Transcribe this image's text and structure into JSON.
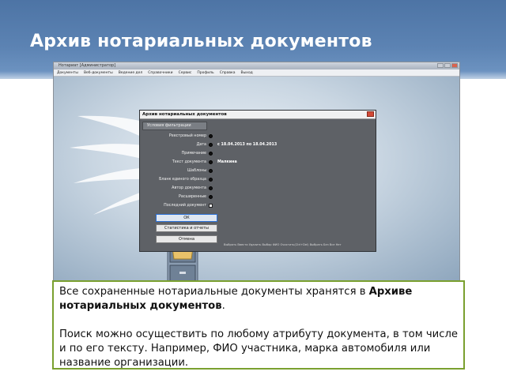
{
  "slide": {
    "title": "Архив нотариальных документов"
  },
  "app": {
    "window_title": "Нотариат [Администратор]",
    "menu": [
      "Документы",
      "Веб-документы",
      "Ведение дел",
      "Справочники",
      "Сервис",
      "Профиль",
      "Справка",
      "Выход"
    ]
  },
  "dialog": {
    "title": "Архив нотариальных документов",
    "section_header": "Условия фильтрации",
    "filters": [
      {
        "label": "Реестровый номер",
        "control": "dot",
        "value": ""
      },
      {
        "label": "Дата",
        "control": "dot",
        "value": "с 18.04.2013 по 18.04.2013"
      },
      {
        "label": "Примечание",
        "control": "dot",
        "value": ""
      },
      {
        "label": "Текст документа",
        "control": "dot",
        "value": "Малкина"
      },
      {
        "label": "Шаблоны",
        "control": "dot",
        "value": ""
      },
      {
        "label": "Бланк единого образца",
        "control": "dot",
        "value": ""
      },
      {
        "label": "Автор документа",
        "control": "dot",
        "value": ""
      },
      {
        "label": "Расширенные",
        "control": "dot",
        "value": ""
      },
      {
        "label": "Последний документ",
        "control": "box",
        "value": ""
      }
    ],
    "buttons": {
      "ok": "ОК",
      "stats": "Статистика и отчеты",
      "cancel": "Отмена"
    },
    "status_line": "Выбрать  Ввести  Удалить  Выбор ФИО  Очистить(Ctrl+Del)  Выбрать  Без  Все  Нет"
  },
  "note": {
    "p1_prefix": "Все сохраненные нотариальные документы хранятся в ",
    "p1_bold": "Архиве нотариальных документов",
    "p1_suffix": ".",
    "p2": "Поиск можно осуществить по любому атрибуту документа, в том числе и по его тексту. Например, ФИО участника, марка автомобиля или название организации."
  },
  "colors": {
    "header_blue": "#5c83b3",
    "note_border": "#7aa02f",
    "dialog_bg": "#5e6166"
  }
}
